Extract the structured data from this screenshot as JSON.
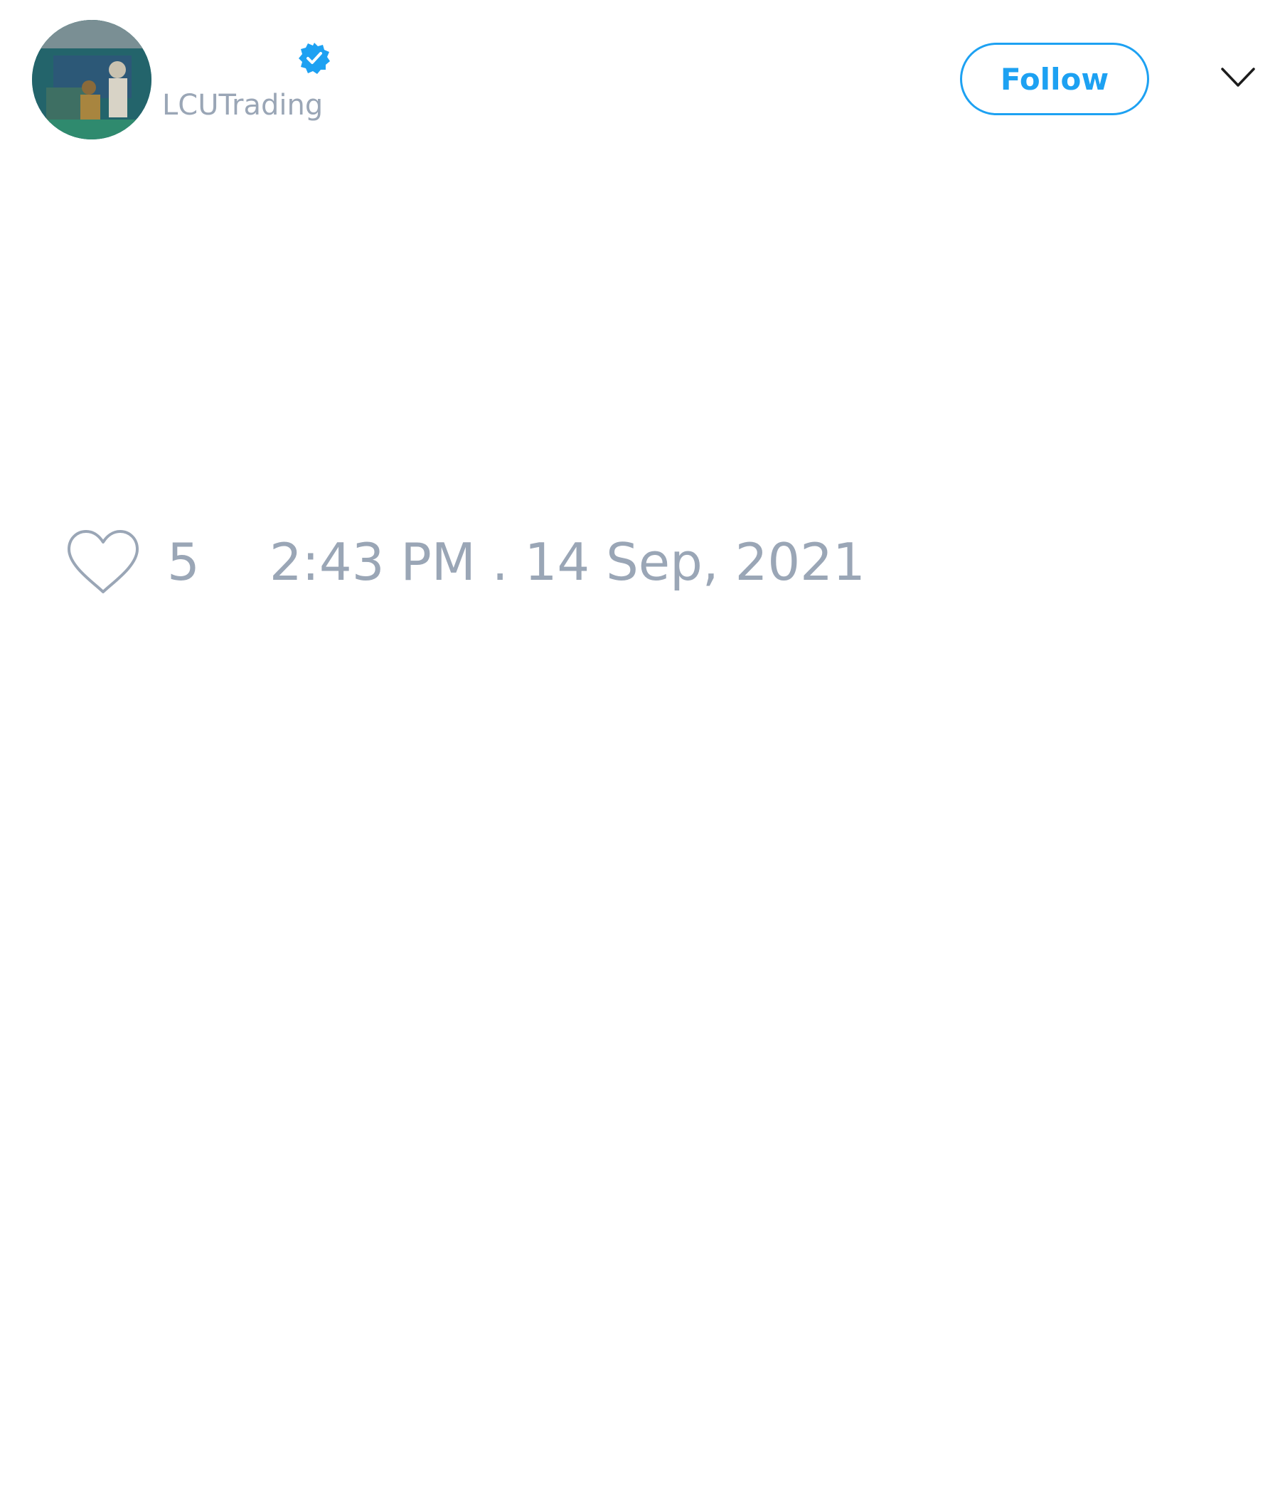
{
  "author": {
    "avatar_icon": "profile-photo",
    "verified_icon": "verified-badge-icon",
    "handle": "LCUTrading"
  },
  "header": {
    "follow_label": "Follow",
    "menu_icon": "chevron-down-icon"
  },
  "tweet": {
    "like_icon": "heart-outline-icon",
    "like_count": "5",
    "timestamp": "2:43 PM . 14 Sep, 2021"
  },
  "colors": {
    "accent": "#1da1f2",
    "muted_text": "#9aa6b6",
    "background": "#ffffff"
  }
}
